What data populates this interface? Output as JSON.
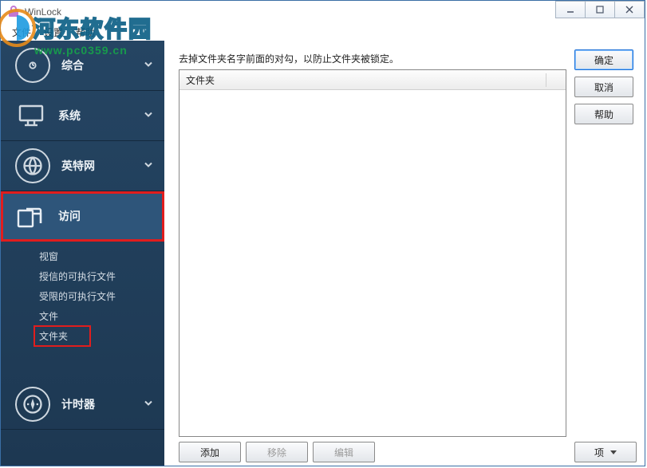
{
  "title": "WinLock",
  "watermark": {
    "name": "河东软件园",
    "url": "www.pc0359.cn"
  },
  "menu": {
    "file": "文件",
    "settings": "设置",
    "help": "帮助"
  },
  "sidebar": {
    "general": "综合",
    "system": "系统",
    "internet": "英特网",
    "access": "访问",
    "timer": "计时器",
    "sub": {
      "window": "视窗",
      "trusted_exe": "授信的可执行文件",
      "restricted_exe": "受限的可执行文件",
      "files": "文件",
      "folders": "文件夹"
    }
  },
  "content": {
    "description": "去掉文件夹名字前面的对勾，以防止文件夹被锁定。",
    "column_folder": "文件夹"
  },
  "buttons": {
    "ok": "确定",
    "cancel": "取消",
    "help": "帮助",
    "add": "添加",
    "remove": "移除",
    "edit": "编辑",
    "items": "项"
  }
}
